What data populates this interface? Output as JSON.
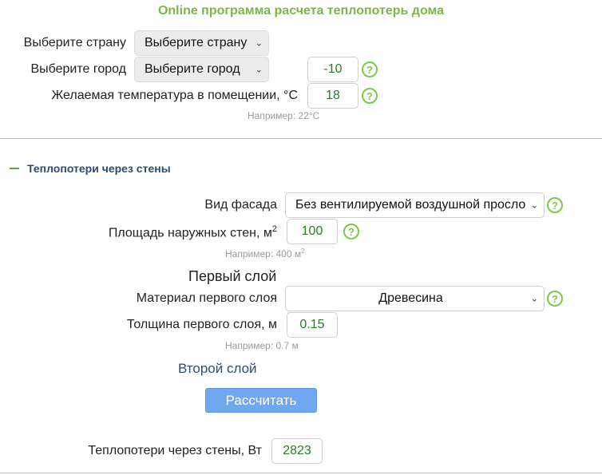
{
  "title": "Online программа расчета теплопотерь дома",
  "country": {
    "label": "Выберите страну",
    "value": "Выберите страну"
  },
  "city": {
    "label": "Выберите город",
    "value": "Выберите город",
    "temp": "-10"
  },
  "indoor": {
    "label": "Желаемая температура в помещении, °C",
    "value": "18",
    "hint": "Например:   22°C"
  },
  "section": {
    "title": "Теплопотери через стены"
  },
  "facade": {
    "label": "Вид фасада",
    "value": "Без вентилируемой воздушной прослойки"
  },
  "area": {
    "label": "Площадь наружных стен, м",
    "sup": "2",
    "value": "100",
    "hint": "Например:   400 м",
    "hint_sup": "2"
  },
  "layer1": {
    "heading": "Первый слой",
    "material_label": "Материал первого слоя",
    "material_value": "Древесина",
    "thickness_label": "Толщина первого слоя, м",
    "thickness_value": "0.15",
    "hint": "Например:   0.7 м"
  },
  "layer2": {
    "link": "Второй слой"
  },
  "calc_button": "Рассчитать",
  "result": {
    "label": "Теплопотери через стены, Вт",
    "value": "2823"
  },
  "help_glyph": "?",
  "chevron_glyph": "⌄",
  "colors": {
    "accent_green": "#7ab648",
    "button_blue": "#6fa8f0",
    "section_blue": "#2a4e72"
  }
}
